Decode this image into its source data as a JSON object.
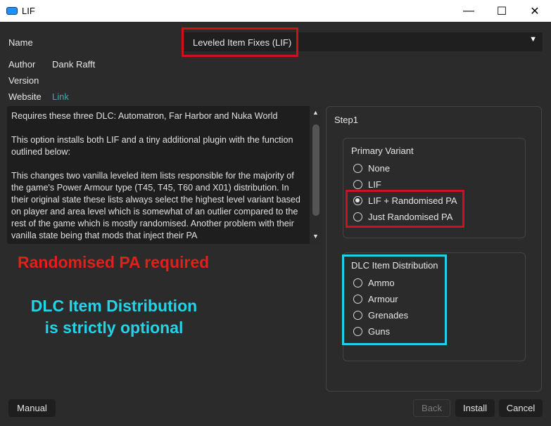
{
  "window": {
    "title": "LIF",
    "minimize_glyph": "—",
    "maximize_glyph": "☐",
    "close_glyph": "✕"
  },
  "info": {
    "name_label": "Name",
    "name_value": "Leveled Item Fixes (LIF)",
    "author_label": "Author",
    "author_value": "Dank Rafft",
    "version_label": "Version",
    "website_label": "Website",
    "website_link": "Link"
  },
  "description": "Requires these three DLC: Automatron, Far Harbor and Nuka World\n\nThis option installs both LIF and a tiny additional plugin with the function outlined below:\n\nThis changes two vanilla leveled item lists responsible for the majority of the game's Power Armour type (T45, T45, T60 and X01) distribution. In their original state these lists always select the highest level variant based on player and area level which is somewhat of an outlier compared to the rest of the game which is mostly randomised. Another problem with their vanilla state being that mods that inject their PA",
  "annotations": {
    "red_note": "Randomised PA required",
    "cyan_note_line1": "DLC Item Distribution",
    "cyan_note_line2": "is strictly optional"
  },
  "step": {
    "title": "Step1",
    "primary_variant": {
      "title": "Primary Variant",
      "options": [
        {
          "label": "None",
          "checked": false
        },
        {
          "label": "LIF",
          "checked": false
        },
        {
          "label": "LIF + Randomised PA",
          "checked": true
        },
        {
          "label": "Just Randomised PA",
          "checked": false
        }
      ]
    },
    "dlc_distribution": {
      "title": "DLC Item Distribution",
      "options": [
        {
          "label": "Ammo",
          "checked": false
        },
        {
          "label": "Armour",
          "checked": false
        },
        {
          "label": "Grenades",
          "checked": false
        },
        {
          "label": "Guns",
          "checked": false
        }
      ]
    }
  },
  "buttons": {
    "manual": "Manual",
    "back": "Back",
    "install": "Install",
    "cancel": "Cancel"
  },
  "colors": {
    "highlight_red": "#d0101c",
    "highlight_cyan": "#20d0e5",
    "link": "#3fa7b3"
  }
}
